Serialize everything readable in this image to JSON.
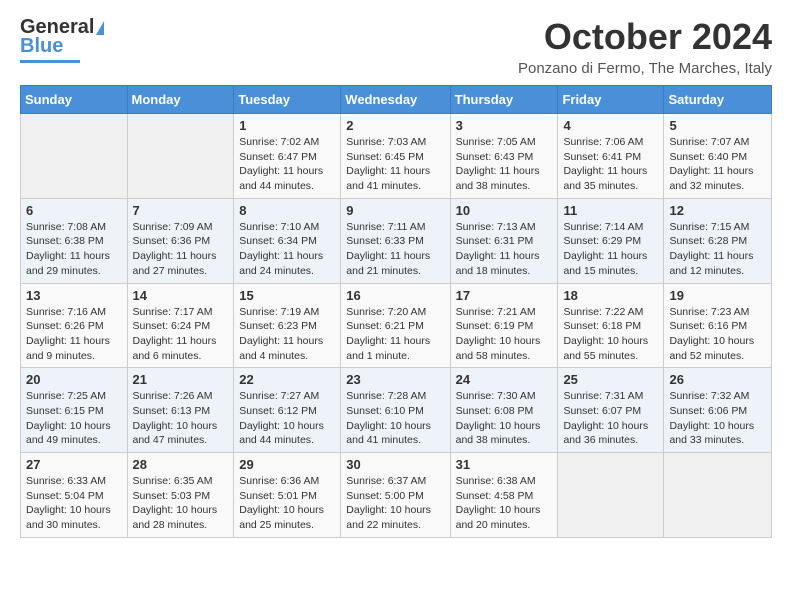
{
  "header": {
    "logo_line1": "General",
    "logo_line2": "Blue",
    "month": "October 2024",
    "location": "Ponzano di Fermo, The Marches, Italy"
  },
  "days_of_week": [
    "Sunday",
    "Monday",
    "Tuesday",
    "Wednesday",
    "Thursday",
    "Friday",
    "Saturday"
  ],
  "weeks": [
    [
      {
        "day": "",
        "info": ""
      },
      {
        "day": "",
        "info": ""
      },
      {
        "day": "1",
        "info": "Sunrise: 7:02 AM\nSunset: 6:47 PM\nDaylight: 11 hours and 44 minutes."
      },
      {
        "day": "2",
        "info": "Sunrise: 7:03 AM\nSunset: 6:45 PM\nDaylight: 11 hours and 41 minutes."
      },
      {
        "day": "3",
        "info": "Sunrise: 7:05 AM\nSunset: 6:43 PM\nDaylight: 11 hours and 38 minutes."
      },
      {
        "day": "4",
        "info": "Sunrise: 7:06 AM\nSunset: 6:41 PM\nDaylight: 11 hours and 35 minutes."
      },
      {
        "day": "5",
        "info": "Sunrise: 7:07 AM\nSunset: 6:40 PM\nDaylight: 11 hours and 32 minutes."
      }
    ],
    [
      {
        "day": "6",
        "info": "Sunrise: 7:08 AM\nSunset: 6:38 PM\nDaylight: 11 hours and 29 minutes."
      },
      {
        "day": "7",
        "info": "Sunrise: 7:09 AM\nSunset: 6:36 PM\nDaylight: 11 hours and 27 minutes."
      },
      {
        "day": "8",
        "info": "Sunrise: 7:10 AM\nSunset: 6:34 PM\nDaylight: 11 hours and 24 minutes."
      },
      {
        "day": "9",
        "info": "Sunrise: 7:11 AM\nSunset: 6:33 PM\nDaylight: 11 hours and 21 minutes."
      },
      {
        "day": "10",
        "info": "Sunrise: 7:13 AM\nSunset: 6:31 PM\nDaylight: 11 hours and 18 minutes."
      },
      {
        "day": "11",
        "info": "Sunrise: 7:14 AM\nSunset: 6:29 PM\nDaylight: 11 hours and 15 minutes."
      },
      {
        "day": "12",
        "info": "Sunrise: 7:15 AM\nSunset: 6:28 PM\nDaylight: 11 hours and 12 minutes."
      }
    ],
    [
      {
        "day": "13",
        "info": "Sunrise: 7:16 AM\nSunset: 6:26 PM\nDaylight: 11 hours and 9 minutes."
      },
      {
        "day": "14",
        "info": "Sunrise: 7:17 AM\nSunset: 6:24 PM\nDaylight: 11 hours and 6 minutes."
      },
      {
        "day": "15",
        "info": "Sunrise: 7:19 AM\nSunset: 6:23 PM\nDaylight: 11 hours and 4 minutes."
      },
      {
        "day": "16",
        "info": "Sunrise: 7:20 AM\nSunset: 6:21 PM\nDaylight: 11 hours and 1 minute."
      },
      {
        "day": "17",
        "info": "Sunrise: 7:21 AM\nSunset: 6:19 PM\nDaylight: 10 hours and 58 minutes."
      },
      {
        "day": "18",
        "info": "Sunrise: 7:22 AM\nSunset: 6:18 PM\nDaylight: 10 hours and 55 minutes."
      },
      {
        "day": "19",
        "info": "Sunrise: 7:23 AM\nSunset: 6:16 PM\nDaylight: 10 hours and 52 minutes."
      }
    ],
    [
      {
        "day": "20",
        "info": "Sunrise: 7:25 AM\nSunset: 6:15 PM\nDaylight: 10 hours and 49 minutes."
      },
      {
        "day": "21",
        "info": "Sunrise: 7:26 AM\nSunset: 6:13 PM\nDaylight: 10 hours and 47 minutes."
      },
      {
        "day": "22",
        "info": "Sunrise: 7:27 AM\nSunset: 6:12 PM\nDaylight: 10 hours and 44 minutes."
      },
      {
        "day": "23",
        "info": "Sunrise: 7:28 AM\nSunset: 6:10 PM\nDaylight: 10 hours and 41 minutes."
      },
      {
        "day": "24",
        "info": "Sunrise: 7:30 AM\nSunset: 6:08 PM\nDaylight: 10 hours and 38 minutes."
      },
      {
        "day": "25",
        "info": "Sunrise: 7:31 AM\nSunset: 6:07 PM\nDaylight: 10 hours and 36 minutes."
      },
      {
        "day": "26",
        "info": "Sunrise: 7:32 AM\nSunset: 6:06 PM\nDaylight: 10 hours and 33 minutes."
      }
    ],
    [
      {
        "day": "27",
        "info": "Sunrise: 6:33 AM\nSunset: 5:04 PM\nDaylight: 10 hours and 30 minutes."
      },
      {
        "day": "28",
        "info": "Sunrise: 6:35 AM\nSunset: 5:03 PM\nDaylight: 10 hours and 28 minutes."
      },
      {
        "day": "29",
        "info": "Sunrise: 6:36 AM\nSunset: 5:01 PM\nDaylight: 10 hours and 25 minutes."
      },
      {
        "day": "30",
        "info": "Sunrise: 6:37 AM\nSunset: 5:00 PM\nDaylight: 10 hours and 22 minutes."
      },
      {
        "day": "31",
        "info": "Sunrise: 6:38 AM\nSunset: 4:58 PM\nDaylight: 10 hours and 20 minutes."
      },
      {
        "day": "",
        "info": ""
      },
      {
        "day": "",
        "info": ""
      }
    ]
  ]
}
